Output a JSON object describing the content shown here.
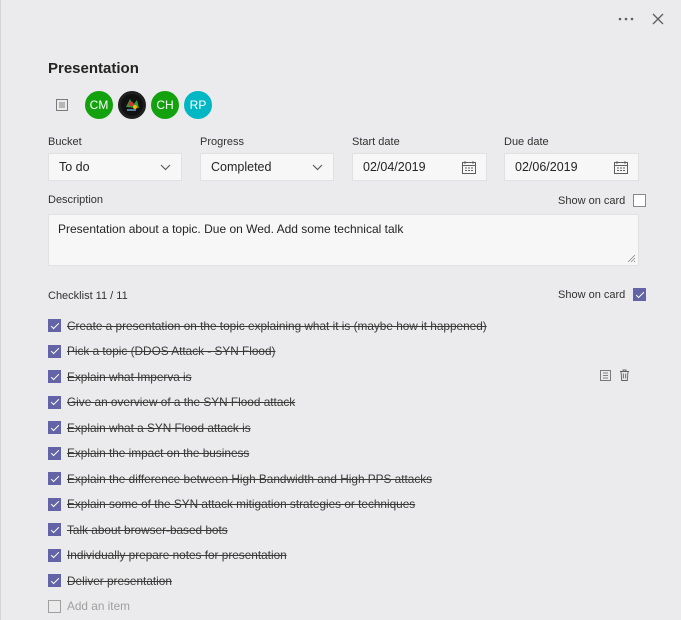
{
  "title": "Presentation",
  "assignees": [
    {
      "initials": "CM",
      "color": "#13a10e"
    },
    {
      "initials": "",
      "color": "#2b2b2b",
      "photo": true
    },
    {
      "initials": "CH",
      "color": "#13a10e"
    },
    {
      "initials": "RP",
      "color": "#00b7c3"
    }
  ],
  "fields": {
    "bucket": {
      "label": "Bucket",
      "value": "To do"
    },
    "progress": {
      "label": "Progress",
      "value": "Completed"
    },
    "start_date": {
      "label": "Start date",
      "value": "02/04/2019"
    },
    "due_date": {
      "label": "Due date",
      "value": "02/06/2019"
    }
  },
  "description": {
    "label": "Description",
    "show_on_card_label": "Show on card",
    "show_on_card": false,
    "text": "Presentation about a topic. Due on Wed. Add some technical talk"
  },
  "checklist": {
    "label": "Checklist 11 / 11",
    "show_on_card_label": "Show on card",
    "show_on_card": true,
    "items": [
      {
        "text": "Create a presentation on the topic explaining what it is (maybe how it happened)",
        "done": true
      },
      {
        "text": "Pick a topic (DDOS Attack - SYN Flood)",
        "done": true
      },
      {
        "text": "Explain what Imperva is",
        "done": true
      },
      {
        "text": "Give an overview of a the SYN Flood attack",
        "done": true
      },
      {
        "text": "Explain what a SYN Flood attack is",
        "done": true
      },
      {
        "text": "Explain the impact on the business",
        "done": true
      },
      {
        "text": "Explain the difference between High Bandwidth and High PPS attacks",
        "done": true
      },
      {
        "text": "Explain some of the SYN attack mitigation strategies or techniques",
        "done": true
      },
      {
        "text": "Talk about browser-based bots",
        "done": true
      },
      {
        "text": "Individually prepare notes for presentation",
        "done": true
      },
      {
        "text": "Deliver presentation",
        "done": true
      }
    ],
    "add_placeholder": "Add an item"
  },
  "colors": {
    "accent": "#6264a7",
    "panel": "#ebebed",
    "field": "#f7f7f8"
  }
}
